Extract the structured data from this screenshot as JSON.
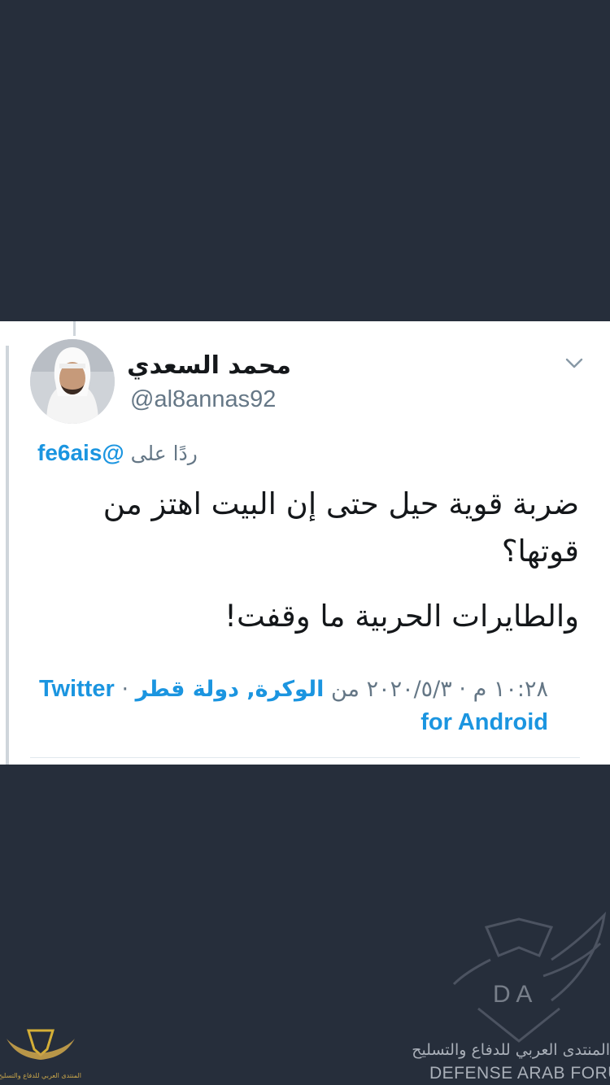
{
  "tweet": {
    "display_name": "محمد السعدي",
    "handle": "@al8annas92",
    "reply_prefix": "ردًا على",
    "reply_mention": "@fe6ais",
    "body_line1": "ضربة قوية حيل حتى إن البيت اهتز من قوتها؟",
    "body_line2": "والطايرات الحربية ما وقفت!",
    "time": "١٠:٢٨ م",
    "date": "٢٠٢٠/٥/٣",
    "location_prefix": "من",
    "location": "الوكرة, دولة قطر",
    "client": "Twitter for Android",
    "separator": "·"
  },
  "icons": {
    "menu": "chevron-down-icon",
    "avatar": "profile-photo"
  },
  "watermark": {
    "ar": "المنتدى العربي للدفاع والتسليح",
    "en": "DEFENSE ARAB FORUM",
    "logo_letters": "D A",
    "small_ar": "المنتدى العربي للدفاع والتسليح"
  },
  "colors": {
    "background": "#262e3b",
    "card": "#ffffff",
    "text": "#14171a",
    "secondary": "#657786",
    "link": "#1b95e0"
  }
}
